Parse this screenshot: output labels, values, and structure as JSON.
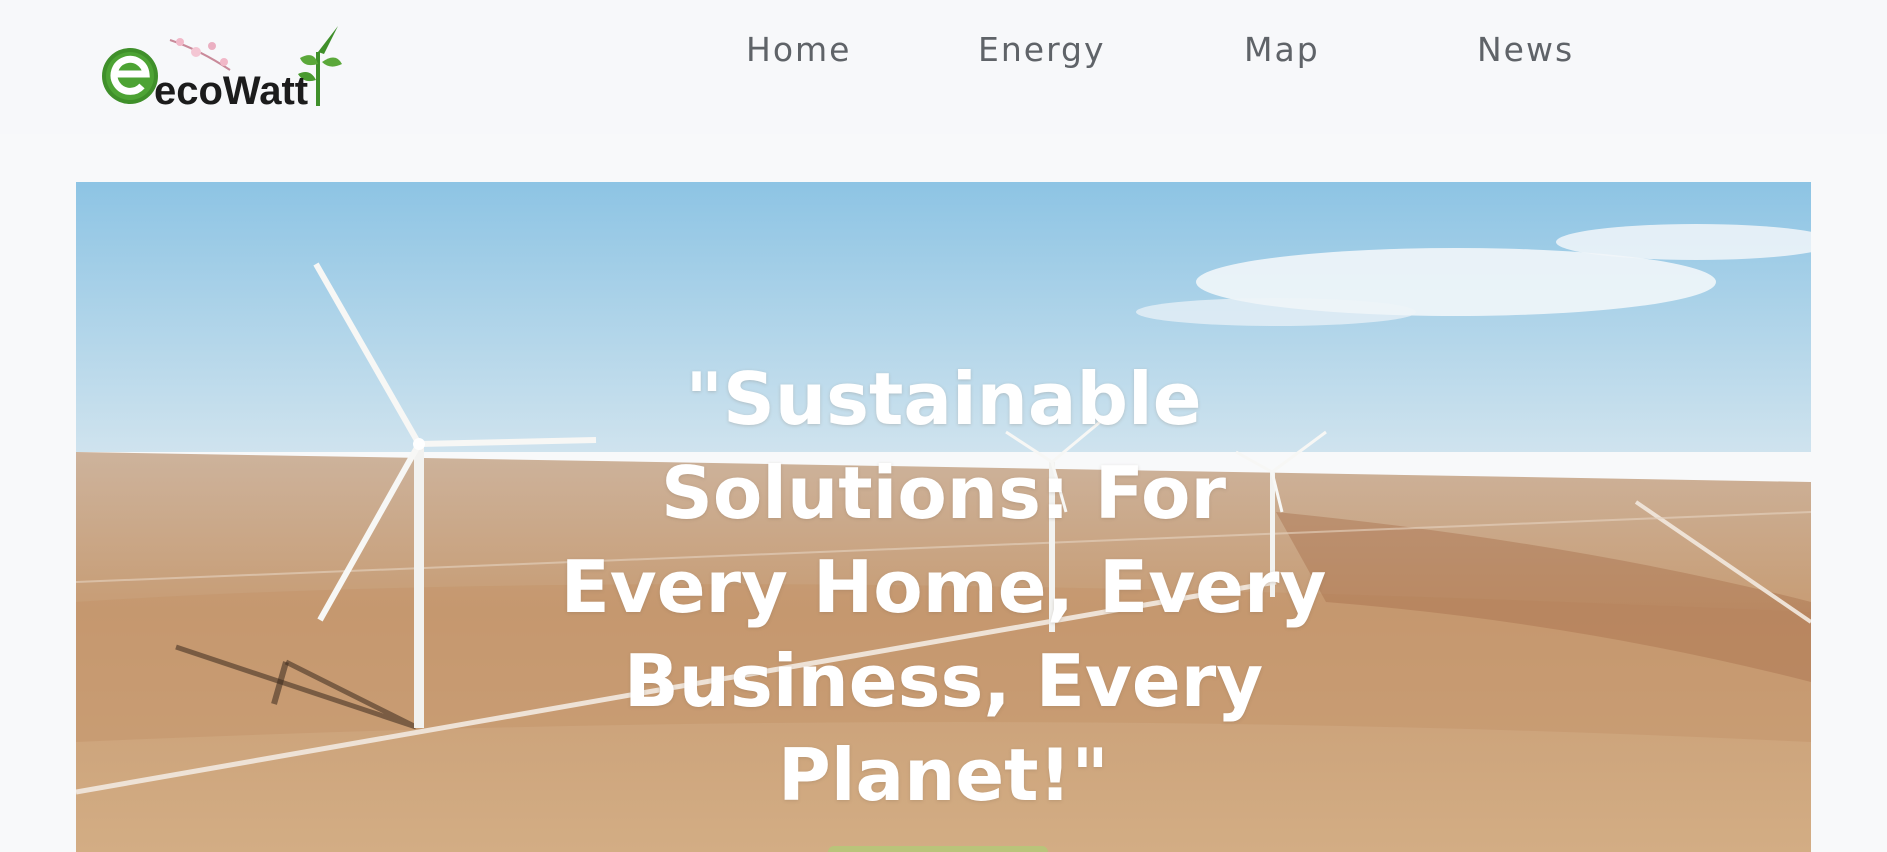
{
  "header": {
    "logo": {
      "name": "ecowatt-logo",
      "text": "ecoWatt",
      "accent_color": "#3f8f2a"
    },
    "nav": [
      {
        "label": "Home"
      },
      {
        "label": "Energy"
      },
      {
        "label": "Map"
      },
      {
        "label": "News"
      }
    ]
  },
  "hero": {
    "image": "wind-turbines-desert",
    "headline": "\"Sustainable Solutions: For Every Home, Every Business, Every Planet!\"",
    "cta_color": "#b9c47a"
  },
  "colors": {
    "page_background": "#f8f9fa",
    "nav_text": "#5f6368",
    "headline_text": "#ffffff"
  }
}
